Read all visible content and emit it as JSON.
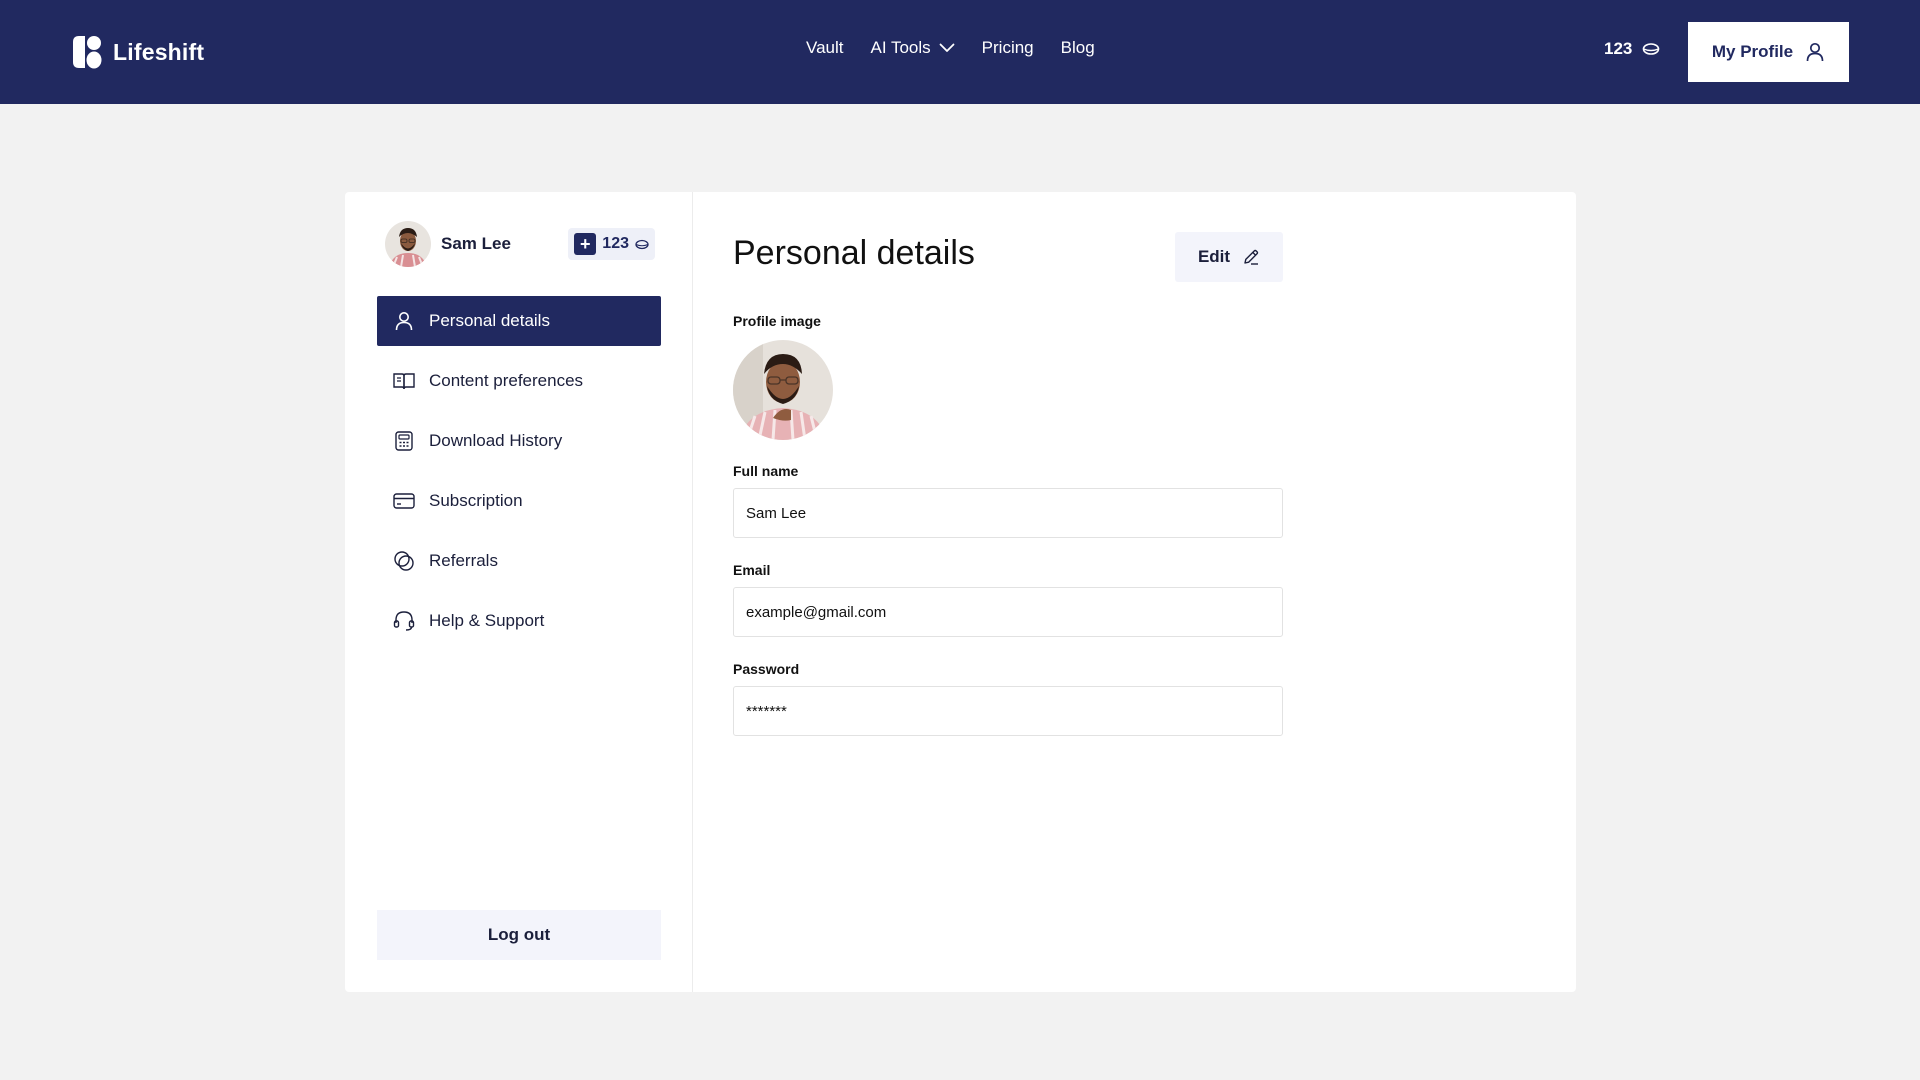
{
  "brand": {
    "name": "Lifeshift"
  },
  "nav": {
    "items": [
      {
        "label": "Vault"
      },
      {
        "label": "AI Tools"
      },
      {
        "label": "Pricing"
      },
      {
        "label": "Blog"
      }
    ]
  },
  "header": {
    "credits": "123",
    "profile_label": "My Profile"
  },
  "sidebar": {
    "user_name": "Sam Lee",
    "credits": "123",
    "items": [
      {
        "label": "Personal details",
        "icon": "user-icon",
        "active": true
      },
      {
        "label": "Content preferences",
        "icon": "book-icon",
        "active": false
      },
      {
        "label": "Download History",
        "icon": "calculator-icon",
        "active": false
      },
      {
        "label": "Subscription",
        "icon": "credit-card-icon",
        "active": false
      },
      {
        "label": "Referrals",
        "icon": "referrals-icon",
        "active": false
      },
      {
        "label": "Help & Support",
        "icon": "headset-icon",
        "active": false
      }
    ],
    "logout_label": "Log out"
  },
  "main": {
    "title": "Personal details",
    "edit_label": "Edit",
    "profile_image_label": "Profile image",
    "full_name": {
      "label": "Full name",
      "value": "Sam Lee"
    },
    "email": {
      "label": "Email",
      "value": "example@gmail.com"
    },
    "password": {
      "label": "Password",
      "value": "*******"
    }
  },
  "colors": {
    "primary": "#212960",
    "page_bg": "#f2f2f2",
    "button_bg": "#f3f4fb"
  }
}
